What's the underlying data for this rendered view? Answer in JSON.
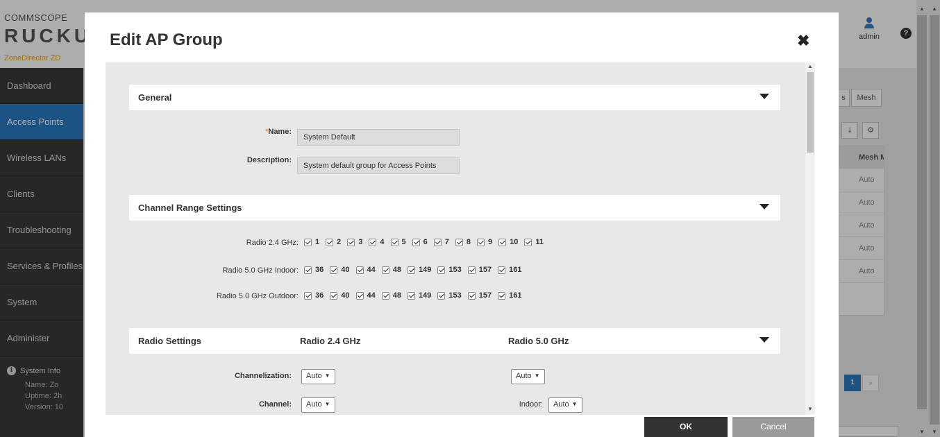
{
  "app": {
    "logo_top": "COMMSCOPE",
    "logo_main": "RUCKUS",
    "logo_sub": "ZoneDirector ZD",
    "user_label": "admin",
    "help_glyph": "?"
  },
  "sidebar": {
    "items": [
      {
        "label": "Dashboard",
        "active": false
      },
      {
        "label": "Access Points",
        "active": true
      },
      {
        "label": "Wireless LANs",
        "active": false
      },
      {
        "label": "Clients",
        "active": false
      },
      {
        "label": "Troubleshooting",
        "active": false
      },
      {
        "label": "Services & Profiles",
        "active": false
      },
      {
        "label": "System",
        "active": false
      },
      {
        "label": "Administer",
        "active": false
      }
    ],
    "system_info": {
      "title": "System Info",
      "rows": [
        "Name:   Zo",
        "Uptime:   2h",
        "Version:   10"
      ]
    }
  },
  "background": {
    "tab_partial": "s",
    "tab_mesh": "Mesh",
    "download_glyph": "⤓",
    "gear_glyph": "⚙",
    "table_header": "Mesh M",
    "rows": [
      "Auto",
      "Auto",
      "Auto",
      "Auto",
      "Auto"
    ],
    "page_current": "1",
    "page_next": "»"
  },
  "modal": {
    "title": "Edit AP Group",
    "close_glyph": "✖",
    "general": {
      "title": "General",
      "name_label": "Name:",
      "name_required_mark": "*",
      "name_value": "System Default",
      "description_label": "Description:",
      "description_value": "System default group for Access Points"
    },
    "channel_range": {
      "title": "Channel Range Settings",
      "radio24_label": "Radio 2.4 GHz:",
      "radio24_channels": [
        "1",
        "2",
        "3",
        "4",
        "5",
        "6",
        "7",
        "8",
        "9",
        "10",
        "11"
      ],
      "radio5_indoor_label": "Radio 5.0 GHz Indoor:",
      "radio5_indoor_channels": [
        "36",
        "40",
        "44",
        "48",
        "149",
        "153",
        "157",
        "161"
      ],
      "radio5_outdoor_label": "Radio 5.0 GHz Outdoor:",
      "radio5_outdoor_channels": [
        "36",
        "40",
        "44",
        "48",
        "149",
        "153",
        "157",
        "161"
      ]
    },
    "radio_settings": {
      "title": "Radio Settings",
      "col_24": "Radio 2.4 GHz",
      "col_50": "Radio 5.0 GHz",
      "channelization_label": "Channelization:",
      "channelization_24": "Auto",
      "channelization_50": "Auto",
      "channel_label": "Channel:",
      "channel_24": "Auto",
      "indoor_label": "Indoor:",
      "channel_50_indoor": "Auto"
    },
    "ok_label": "OK",
    "cancel_label": "Cancel"
  }
}
